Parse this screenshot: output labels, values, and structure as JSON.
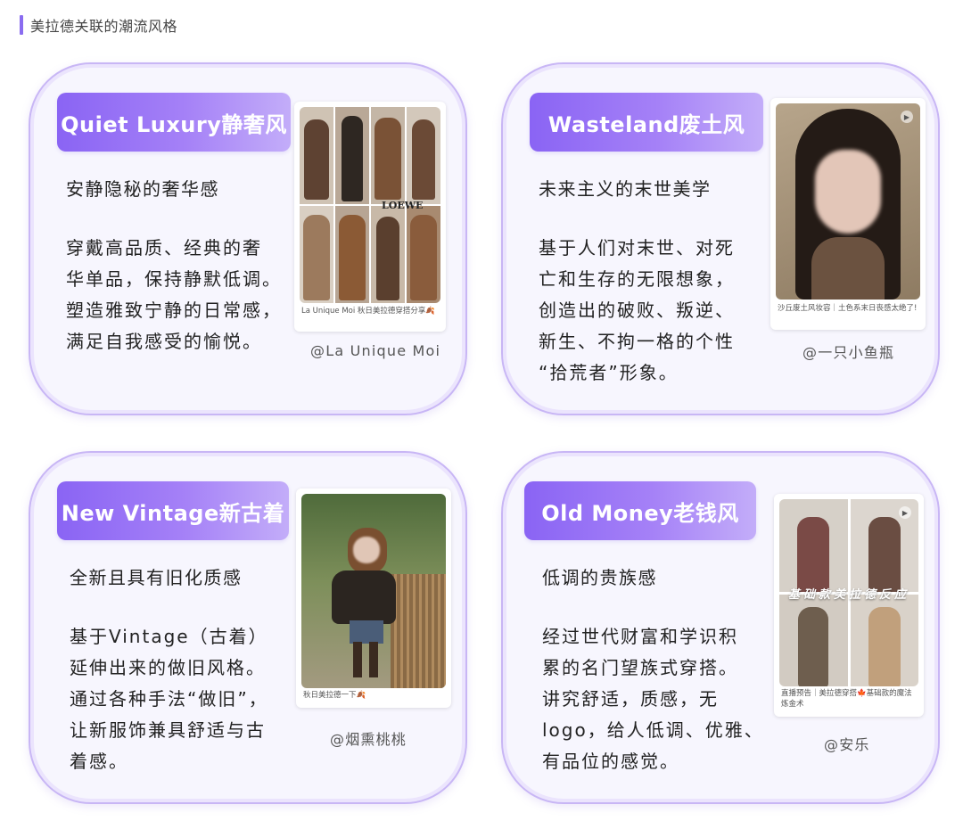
{
  "header": {
    "title": "美拉德关联的潮流风格"
  },
  "cards": [
    {
      "title": "Quiet Luxury静奢风",
      "subtitle": "安静隐秘的奢华感",
      "body": [
        "穿戴高品质、经典的奢",
        "华单品，保持静默低调。",
        "塑造雅致宁静的日常感，",
        "满足自我感受的愉悦。"
      ],
      "photo_caption": "La Unique Moi 秋日美拉德穿搭分享🍂",
      "photo_overlay": "LOEWE",
      "credit": "@La Unique Moi"
    },
    {
      "title": "Wasteland废土风",
      "subtitle": "未来主义的末世美学",
      "body": [
        "基于人们对末世、对死",
        "亡和生存的无限想象，",
        "创造出的破败、叛逆、",
        "新生、不拘一格的个性",
        "“拾荒者”形象。"
      ],
      "photo_caption": "沙丘废土风妆容｜土色系末日丧感太绝了!",
      "credit": "@一只小鱼瓶"
    },
    {
      "title": "New Vintage新古着",
      "subtitle": "全新且具有旧化质感",
      "body": [
        "基于Vintage（古着）",
        "延伸出来的做旧风格。",
        "通过各种手法“做旧”，",
        "让新服饰兼具舒适与古",
        "着感。"
      ],
      "photo_caption": "秋日美拉德一下🍂",
      "credit": "@烟熏桃桃"
    },
    {
      "title": "Old Money老钱风",
      "subtitle": "低调的贵族感",
      "body": [
        "经过世代财富和学识积",
        "累的名门望族式穿搭。",
        "讲究舒适，质感，无",
        "logo，给人低调、优雅、",
        "有品位的感觉。"
      ],
      "photo_caption": "直播预告｜美拉德穿搭🍁基础款的魔法炼金术",
      "photo_overlay": "基础款美拉德反应",
      "credit": "@安乐"
    }
  ],
  "colors": {
    "accent": "#8a6cf0",
    "pill_start": "#8a64f4",
    "pill_end": "#c3adf9",
    "card_border": "#c8b6f5",
    "card_bg": "#f7f6fe"
  },
  "icons": {
    "play": "play-icon"
  }
}
